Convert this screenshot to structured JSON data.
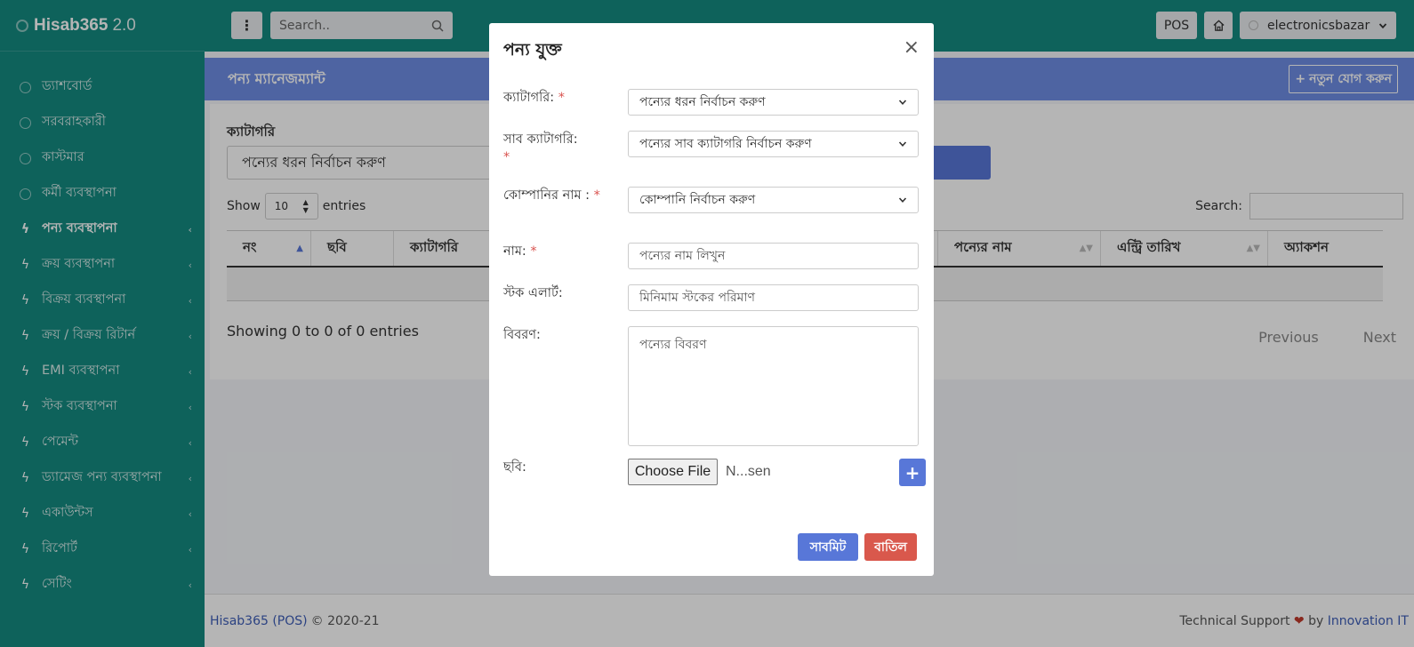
{
  "app": {
    "brand": "Hisab365",
    "version": "2.0"
  },
  "topbar": {
    "search_placeholder": "Search..",
    "pos_label": "POS",
    "user_name": "electronicsbazar"
  },
  "sidebar": {
    "items": [
      {
        "label": "ড্যাশবোর্ড",
        "icon": "circle-icon"
      },
      {
        "label": "সরবরাহকারী",
        "icon": "circle-icon"
      },
      {
        "label": "কাস্টমার",
        "icon": "circle-icon"
      },
      {
        "label": "কর্মী ব্যবস্থাপনা",
        "icon": "circle-icon"
      },
      {
        "label": "পন্য ব্যবস্থাপনা",
        "icon": "bolt-icon",
        "active": true,
        "chevron": true
      },
      {
        "label": "ক্রয় ব্যবস্থাপনা",
        "icon": "bolt-icon",
        "chevron": true
      },
      {
        "label": "বিক্রয় ব্যবস্থাপনা",
        "icon": "bolt-icon",
        "chevron": true
      },
      {
        "label": "ক্রয় / বিক্রয় রিটার্ন",
        "icon": "bolt-icon",
        "chevron": true
      },
      {
        "label": "EMI ব্যবস্থাপনা",
        "icon": "bolt-icon",
        "chevron": true
      },
      {
        "label": "স্টক ব্যবস্থাপনা",
        "icon": "bolt-icon",
        "chevron": true
      },
      {
        "label": "পেমেন্ট",
        "icon": "bolt-icon",
        "chevron": true
      },
      {
        "label": "ড্যামেজ পন্য ব্যবস্থাপনা",
        "icon": "bolt-icon",
        "chevron": true
      },
      {
        "label": "একাউন্টস",
        "icon": "bolt-icon",
        "chevron": true
      },
      {
        "label": "রিপোর্ট",
        "icon": "bolt-icon",
        "chevron": true
      },
      {
        "label": "সেটিং",
        "icon": "bolt-icon",
        "chevron": true
      }
    ]
  },
  "page": {
    "title": "পন্য ম্যানেজম্যান্ট",
    "add_new_label": "নতুন যোগ করুন",
    "category_filter_label": "ক্যাটাগরি",
    "category_filter_value": "পন্যের ধরন নির্বাচন করুণ",
    "show_label": "Show",
    "page_length": "10",
    "entries_label": "entries",
    "search_label": "Search:",
    "columns": [
      "নং",
      "ছবি",
      "ক্যাটাগরি",
      "পন্যের নাম",
      "এন্ট্রি তারিখ",
      "অ্যাকশন"
    ],
    "info": "Showing 0 to 0 of 0 entries",
    "prev_label": "Previous",
    "next_label": "Next"
  },
  "modal": {
    "title": "পন্য যুক্ত",
    "close_label": "×",
    "category_label": "ক্যাটাগরি:",
    "category_value": "পন্যের ধরন নির্বাচন করুণ",
    "subcategory_label": "সাব ক্যাটাগরি:",
    "subcategory_value": "পন্যের সাব ক্যাটাগরি নির্বাচন করুণ",
    "company_label": "কোম্পানির নাম :",
    "company_value": "কোম্পানি নির্বাচন করুণ",
    "name_label": "নাম:",
    "name_placeholder": "পন্যের নাম লিখুন",
    "stock_alert_label": "স্টক এলার্ট:",
    "stock_alert_placeholder": "মিনিমাম স্টকের পরিমাণ",
    "description_label": "বিবরণ:",
    "description_placeholder": "পন্যের বিবরণ",
    "image_label": "ছবি:",
    "choose_file_label": "Choose File",
    "file_name": "N...sen",
    "required_mark": "*",
    "submit_label": "সাবমিট",
    "cancel_label": "বাতিল"
  },
  "footer": {
    "brand_link": "Hisab365 (POS)",
    "copyright": "© 2020-21",
    "support_prefix": "Technical Support",
    "support_by": "by",
    "company_link": "Innovation IT"
  },
  "colors": {
    "sidebar_bg": "#148a80",
    "header_bg": "#6f8ee5",
    "primary": "#5877d8",
    "danger": "#d9584c"
  }
}
